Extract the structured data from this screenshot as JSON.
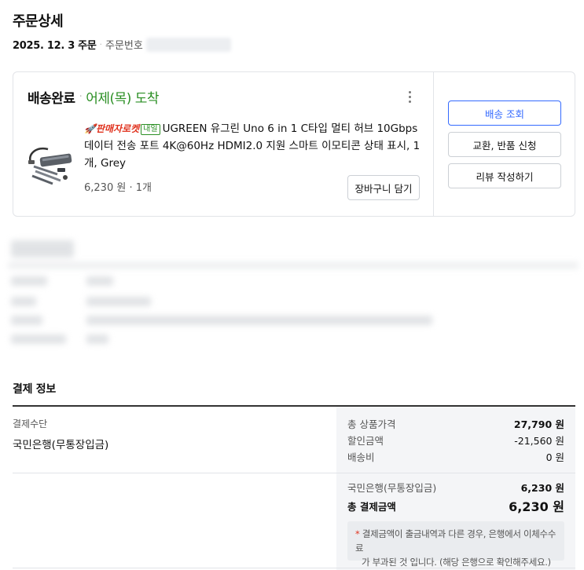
{
  "page": {
    "title": "주문상세",
    "order_date": "2025. 12. 3 주문",
    "order_no_label": "주문번호"
  },
  "shipment": {
    "status": "배송완료",
    "arrival": "어제(목) 도착",
    "product": {
      "rocket_label": "🚀판매자로켓",
      "badge": "내일",
      "name": "UGREEN 유그린 Uno 6 in 1 C타입 멀티 허브 10Gbps 데이터 전송 포트 4K@60Hz HDMI2.0 지원 스마트 이모티콘 상태 표시, 1개, Grey",
      "price_qty": "6,230 원 · 1개"
    },
    "cart_button": "장바구니 담기",
    "actions": {
      "track": "배송 조회",
      "exchange": "교환, 반품 신청",
      "review": "리뷰 작성하기"
    }
  },
  "payment": {
    "section_title": "결제 정보",
    "method_label": "결제수단",
    "method_value": "국민은행(무통장입금)",
    "rows": [
      {
        "label": "총 상품가격",
        "value": "27,790 원"
      },
      {
        "label": "할인금액",
        "value": "-21,560 원"
      },
      {
        "label": "배송비",
        "value": "0 원"
      }
    ],
    "bank_row": {
      "label": "국민은행(무통장입금)",
      "value": "6,230 원"
    },
    "total": {
      "label": "총 결제금액",
      "value": "6,230 원"
    },
    "notice_line1": "결제금액이 출금내역과 다른 경우, 은행에서 이체수수료",
    "notice_line2": "가 부과된 것 입니다. (해당 은행으로 확인해주세요.)",
    "notice_mark": "*"
  },
  "colors": {
    "accent_blue": "#346aff",
    "status_green": "#2b8f24",
    "rocket_red": "#e0321e"
  }
}
